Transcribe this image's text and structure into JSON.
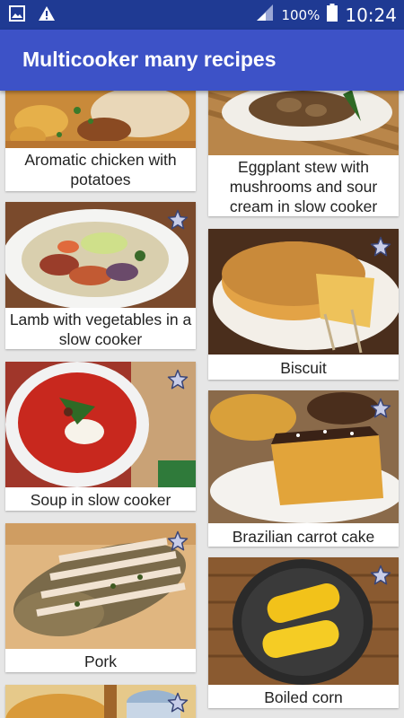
{
  "status_bar": {
    "battery": "100%",
    "time": "10:24",
    "icons": [
      "image-icon",
      "warning-icon",
      "signal-icon",
      "battery-icon"
    ]
  },
  "app_bar": {
    "title": "Multicooker many recipes"
  },
  "recipes": [
    {
      "name": "Aromatic chicken with potatoes",
      "favorite_icon": "star-outline-icon"
    },
    {
      "name": "Eggplant stew with mushrooms and sour cream in slow cooker",
      "favorite_icon": "star-outline-icon"
    },
    {
      "name": "Lamb with vegetables in a slow cooker",
      "favorite_icon": "star-outline-icon"
    },
    {
      "name": "Biscuit",
      "favorite_icon": "star-outline-icon"
    },
    {
      "name": "Soup in slow cooker",
      "favorite_icon": "star-outline-icon"
    },
    {
      "name": "Brazilian carrot cake",
      "favorite_icon": "star-outline-icon"
    },
    {
      "name": "Pork",
      "favorite_icon": "star-outline-icon"
    },
    {
      "name": "Boiled corn",
      "favorite_icon": "star-outline-icon"
    },
    {
      "name": "",
      "favorite_icon": "star-outline-icon"
    }
  ],
  "colors": {
    "status_bar": "#1f3a93",
    "app_bar": "#3d52c7",
    "background": "#e6e6e6",
    "star_fill": "#c8cde8",
    "star_stroke": "#3a4577"
  }
}
